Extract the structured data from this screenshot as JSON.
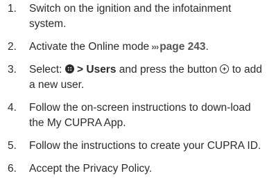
{
  "steps": [
    {
      "number": "1.",
      "text": "Switch on the ignition and the infotainment system."
    },
    {
      "number": "2.",
      "text_before": "Activate the Online mode",
      "link_arrows": "›››",
      "page_ref": "page 243",
      "text_after": "."
    },
    {
      "number": "3.",
      "text_select": "Select:",
      "menu_icon": "menu-grid-icon",
      "path_label": "> Users",
      "text_mid": "and press the button",
      "add_icon": "circle-plus-icon",
      "text_after": "to add a new user."
    },
    {
      "number": "4.",
      "text": "Follow the on-screen instructions to down-load the My CUPRA App."
    },
    {
      "number": "5.",
      "text": "Follow the instructions to create your CUPRA ID."
    },
    {
      "number": "6.",
      "text": "Accept the Privacy Policy."
    }
  ]
}
